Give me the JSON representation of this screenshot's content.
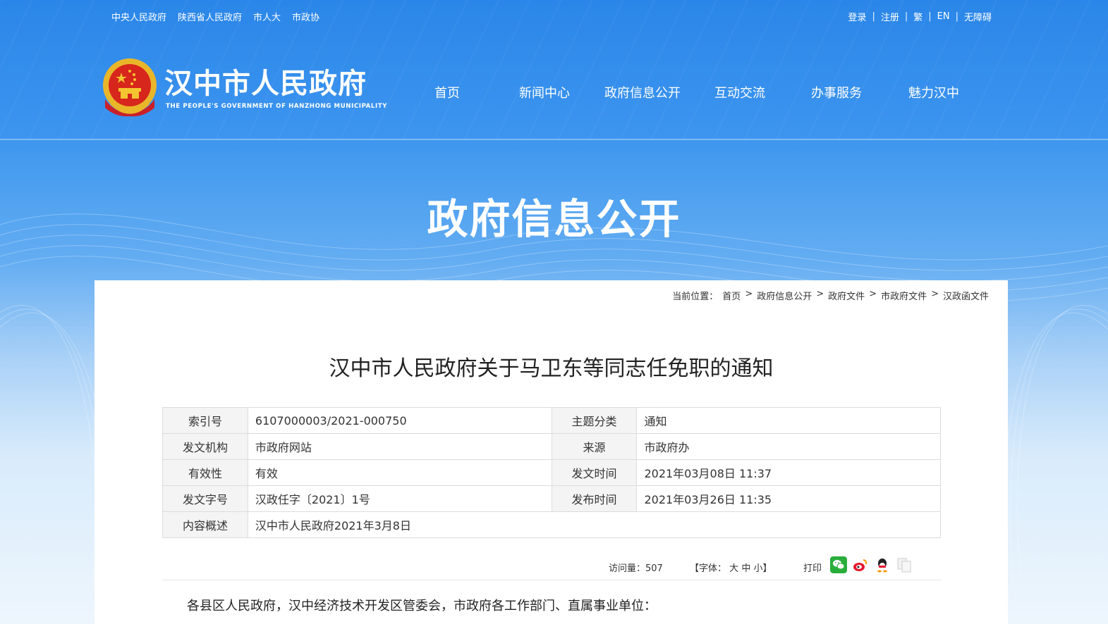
{
  "top_links": [
    "中央人民政府",
    "陕西省人民政府",
    "市人大",
    "市政协"
  ],
  "account_links": [
    "登录",
    "注册",
    "繁",
    "EN",
    "无障碍"
  ],
  "logo": {
    "title": "汉中市人民政府",
    "subtitle": "THE PEOPLE'S GOVERNMENT OF HANZHONG MUNICIPALITY"
  },
  "nav": [
    "首页",
    "新闻中心",
    "政府信息公开",
    "互动交流",
    "办事服务",
    "魅力汉中"
  ],
  "banner_title": "政府信息公开",
  "breadcrumb": {
    "label": "当前位置：",
    "items": [
      "首页",
      "政府信息公开",
      "政府文件",
      "市政府文件",
      "汉政函文件"
    ],
    "separator": ">"
  },
  "doc_title": "汉中市人民政府关于马卫东等同志任免职的通知",
  "meta": {
    "index_label": "索引号",
    "index_value": "6107000003/2021-000750",
    "topic_label": "主题分类",
    "topic_value": "通知",
    "issuer_label": "发文机构",
    "issuer_value": "市政府网站",
    "source_label": "来源",
    "source_value": "市政府办",
    "validity_label": "有效性",
    "validity_value": "有效",
    "date_label": "发文时间",
    "date_value": "2021年03月08日 11:37",
    "docno_label": "发文字号",
    "docno_value": "汉政任字〔2021〕1号",
    "pubdate_label": "发布时间",
    "pubdate_value": "2021年03月26日 11:35",
    "summary_label": "内容概述",
    "summary_value": "汉中市人民政府2021年3月8日"
  },
  "toolbar": {
    "visits_label": "访问量：",
    "visits": "507",
    "font_label": "【字体：",
    "font_large": "大",
    "font_medium": "中",
    "font_small": "小",
    "font_end": "】",
    "print": "打印"
  },
  "share_icons": [
    "wechat-icon",
    "weibo-icon",
    "qq-icon",
    "copy-icon"
  ],
  "body_first_line": "各县区人民政府，汉中经济技术开发区管委会，市政府各工作部门、直属事业单位："
}
